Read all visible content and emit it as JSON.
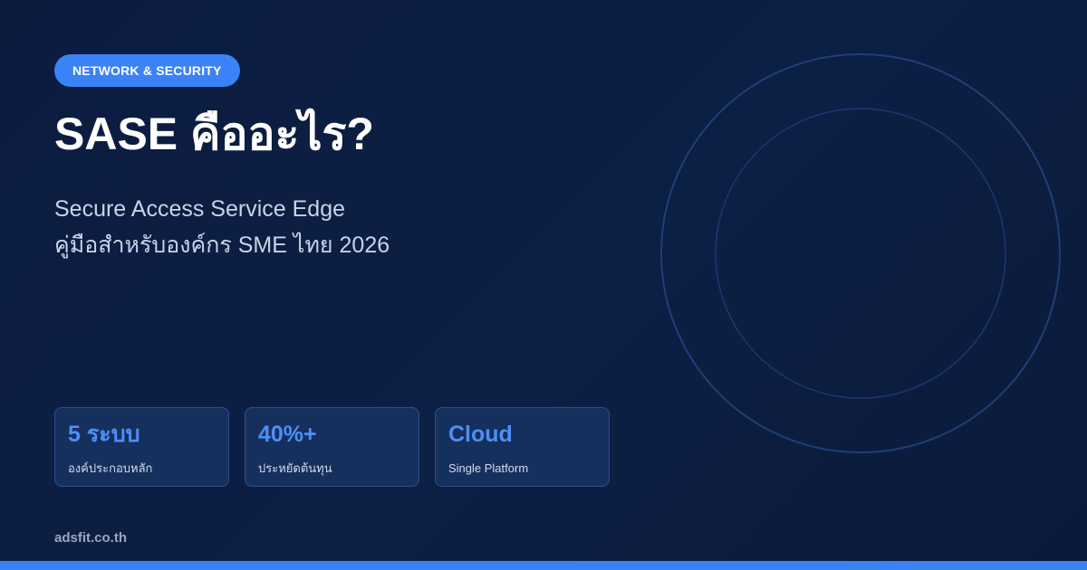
{
  "badge": {
    "label": "NETWORK & SECURITY"
  },
  "heading": {
    "title": "SASE คืออะไร?"
  },
  "subtitle": {
    "line1": "Secure Access Service Edge",
    "line2": "คู่มือสำหรับองค์กร SME ไทย 2026"
  },
  "stats": [
    {
      "value": "5 ระบบ",
      "label": "องค์ประกอบหลัก"
    },
    {
      "value": "40%+",
      "label": "ประหยัดต้นทุน"
    },
    {
      "value": "Cloud",
      "label": "Single Platform"
    }
  ],
  "footer": {
    "domain": "adsfit.co.th"
  },
  "colors": {
    "background": "#0b1c3f",
    "accent": "#3b82f6",
    "stat_value": "#4d8ff7",
    "card_background": "#16305e",
    "card_border": "#2b4f8f"
  },
  "decor": {
    "icon": "concentric-rings"
  }
}
